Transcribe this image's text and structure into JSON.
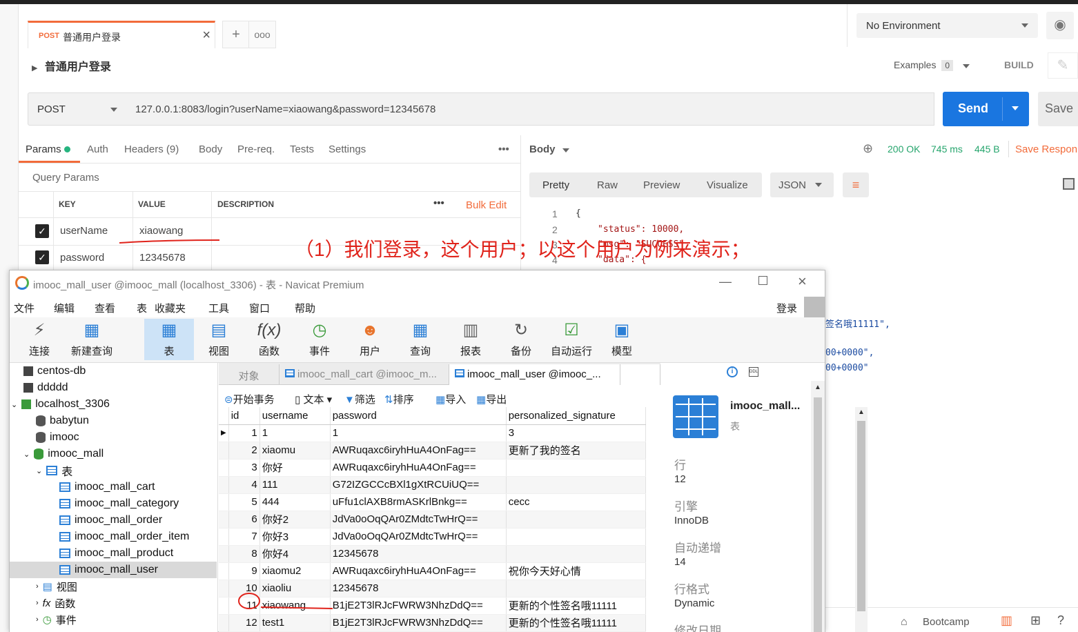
{
  "postman": {
    "tab": {
      "method": "POST",
      "title": "普通用户登录"
    },
    "environment": "No Environment",
    "request_name": "普通用户登录",
    "examples_label": "Examples",
    "examples_count": "0",
    "build_label": "BUILD",
    "method": "POST",
    "url": "127.0.0.1:8083/login?userName=xiaowang&password=12345678",
    "send_label": "Send",
    "save_label": "Save",
    "req_tabs": [
      "Params",
      "Auth",
      "Headers (9)",
      "Body",
      "Pre-req.",
      "Tests",
      "Settings"
    ],
    "query_params_label": "Query Params",
    "columns": {
      "key": "KEY",
      "value": "VALUE",
      "description": "DESCRIPTION"
    },
    "bulk_edit": "Bulk Edit",
    "params": [
      {
        "key": "userName",
        "value": "xiaowang",
        "checked": true
      },
      {
        "key": "password",
        "value": "12345678",
        "checked": true
      }
    ],
    "response": {
      "body_label": "Body",
      "status": "200 OK",
      "time": "745 ms",
      "size": "445 B",
      "save_response": "Save Respon",
      "views": [
        "Pretty",
        "Raw",
        "Preview",
        "Visualize"
      ],
      "format": "JSON",
      "code_lines": [
        "{",
        "\"status\": 10000,",
        "\"msg\": \"SUCCESS\",",
        "\"data\": {"
      ],
      "line_numbers": [
        "1",
        "2",
        "3",
        "4"
      ],
      "partial_lines": [
        "签名哦11111\",",
        "00+0000\",",
        "00+0000\""
      ]
    },
    "footer": {
      "bootcamp": "Bootcamp"
    }
  },
  "annotation": "（1）我们登录，这个用户；以这个用户为例来演示；",
  "navicat": {
    "title": "imooc_mall_user @imooc_mall (localhost_3306) - 表 - Navicat Premium",
    "menu": [
      "文件",
      "编辑",
      "查看",
      "表",
      "收藏夹",
      "工具",
      "窗口",
      "帮助"
    ],
    "login": "登录",
    "toolbar": [
      "连接",
      "新建查询",
      "表",
      "视图",
      "函数",
      "事件",
      "用户",
      "查询",
      "报表",
      "备份",
      "自动运行",
      "模型"
    ],
    "tree": {
      "connections": [
        "centos-db",
        "ddddd",
        "localhost_3306"
      ],
      "databases": [
        "babytun",
        "imooc",
        "imooc_mall"
      ],
      "tables_label": "表",
      "tables": [
        "imooc_mall_cart",
        "imooc_mall_category",
        "imooc_mall_order",
        "imooc_mall_order_item",
        "imooc_mall_product",
        "imooc_mall_user"
      ],
      "other": [
        "视图",
        "函数",
        "事件"
      ]
    },
    "object_tabs": [
      "对象",
      "imooc_mall_cart @imooc_m...",
      "imooc_mall_user @imooc_..."
    ],
    "data_toolbar": [
      "开始事务",
      "文本",
      "筛选",
      "排序",
      "导入",
      "导出"
    ],
    "columns": [
      "id",
      "username",
      "password",
      "personalized_signature"
    ],
    "rows": [
      [
        "1",
        "1",
        "1",
        "3"
      ],
      [
        "2",
        "xiaomu",
        "AWRuqaxc6iryhHuA4OnFag==",
        "更新了我的签名"
      ],
      [
        "3",
        "你好",
        "AWRuqaxc6iryhHuA4OnFag==",
        ""
      ],
      [
        "4",
        "111",
        "G72IZGCCcBXl1gXtRCUiUQ==",
        ""
      ],
      [
        "5",
        "444",
        "uFfu1clAXB8rmASKrlBnkg==",
        "cecc"
      ],
      [
        "6",
        "你好2",
        "JdVa0oOqQAr0ZMdtcTwHrQ==",
        ""
      ],
      [
        "7",
        "你好3",
        "JdVa0oOqQAr0ZMdtcTwHrQ==",
        ""
      ],
      [
        "8",
        "你好4",
        "12345678",
        ""
      ],
      [
        "9",
        "xiaomu2",
        "AWRuqaxc6iryhHuA4OnFag==",
        "祝你今天好心情"
      ],
      [
        "10",
        "xiaoliu",
        "12345678",
        ""
      ],
      [
        "11",
        "xiaowang",
        "B1jE2T3lRJcFWRW3NhzDdQ==",
        "更新的个性签名哦11111"
      ],
      [
        "12",
        "test1",
        "B1jE2T3lRJcFWRW3NhzDdQ==",
        "更新的个性签名哦11111"
      ]
    ],
    "info": {
      "name": "imooc_mall...",
      "type": "表",
      "rows_label": "行",
      "rows_value": "12",
      "engine_label": "引擎",
      "engine_value": "InnoDB",
      "autoinc_label": "自动递增",
      "autoinc_value": "14",
      "format_label": "行格式",
      "format_value": "Dynamic",
      "modified_label": "修改日期"
    }
  }
}
